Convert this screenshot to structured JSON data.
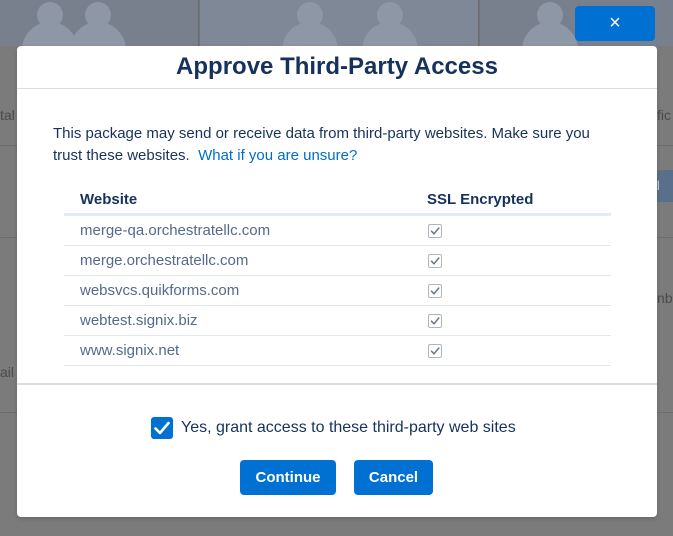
{
  "background": {
    "fragment_left_1": "tal",
    "fragment_left_2": "ail",
    "fragment_right_1": "fic",
    "fragment_right_2": "nb",
    "fragment_button": "ll"
  },
  "close_button": {
    "icon": "close-icon",
    "glyph": "×"
  },
  "modal": {
    "title": "Approve Third-Party Access",
    "description": "This package may send or receive data from third-party websites. Make sure you trust these websites.",
    "help_link": "What if you are unsure?",
    "table": {
      "columns": [
        "Website",
        "SSL Encrypted"
      ],
      "rows": [
        {
          "website": "merge-qa.orchestratellc.com",
          "ssl_encrypted": true
        },
        {
          "website": "merge.orchestratellc.com",
          "ssl_encrypted": true
        },
        {
          "website": "websvcs.quikforms.com",
          "ssl_encrypted": true
        },
        {
          "website": "webtest.signix.biz",
          "ssl_encrypted": true
        },
        {
          "website": "www.signix.net",
          "ssl_encrypted": true
        }
      ]
    },
    "grant_checkbox": {
      "label": "Yes, grant access to these third-party web sites",
      "checked": true
    },
    "continue_label": "Continue",
    "cancel_label": "Cancel"
  },
  "colors": {
    "brand": "#0070d2",
    "title": "#16325c",
    "link": "#006dcc",
    "muted_text": "#54698d"
  }
}
